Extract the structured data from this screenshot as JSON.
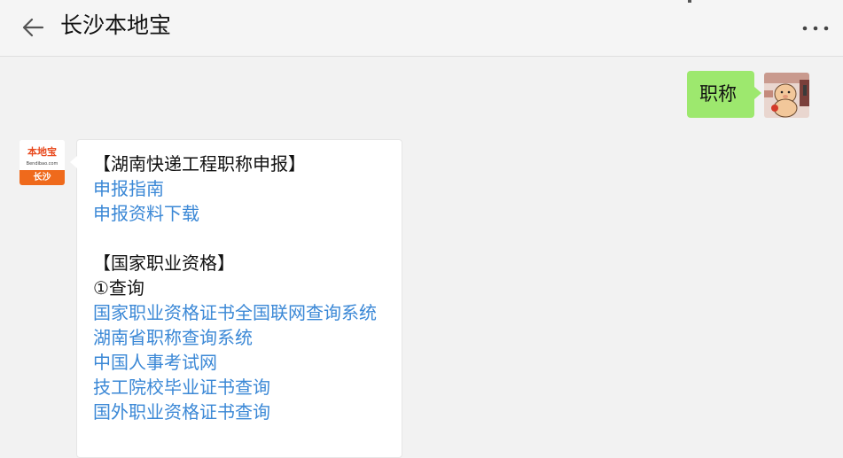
{
  "header": {
    "title": "长沙本地宝"
  },
  "outgoing": {
    "text": "职称"
  },
  "bot": {
    "logo_text": "本地宝",
    "logo_url": "Bendibao.com",
    "logo_city": "长沙"
  },
  "message": {
    "section1_title": "【湖南快递工程职称申报】",
    "section1_links": [
      "申报指南",
      "申报资料下载"
    ],
    "section2_title": "【国家职业资格】",
    "section2_sub": "①查询",
    "section2_links": [
      "国家职业资格证书全国联网查询系统",
      "湖南省职称查询系统",
      "中国人事考试网",
      "技工院校毕业证书查询",
      "国外职业资格证书查询"
    ]
  },
  "colors": {
    "bubble_out": "#9de86e",
    "link": "#3b88d6",
    "logo_orange": "#ef6a1c",
    "background": "#f2f2f2"
  }
}
